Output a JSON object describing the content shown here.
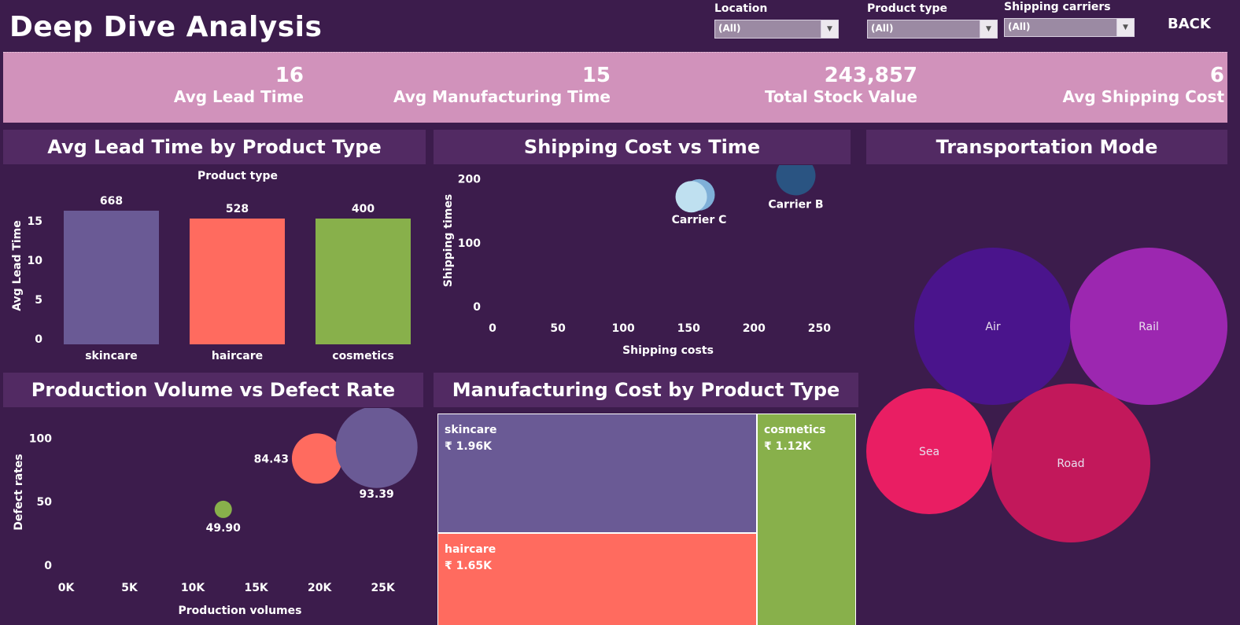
{
  "header": {
    "title": "Deep Dive Analysis",
    "back_label": "BACK"
  },
  "filters": [
    {
      "label": "Location",
      "value": "(All)"
    },
    {
      "label": "Product type",
      "value": "(All)"
    },
    {
      "label": "Shipping carriers",
      "value": "(All)"
    }
  ],
  "kpis": [
    {
      "value": "16",
      "label": "Avg Lead Time"
    },
    {
      "value": "15",
      "label": "Avg Manufacturing Time"
    },
    {
      "value": "243,857",
      "label": "Total Stock Value"
    },
    {
      "value": "6",
      "label": "Avg Shipping Cost"
    }
  ],
  "panels": {
    "lead_time": "Avg Lead Time by Product Type",
    "shipping": "Shipping Cost vs Time",
    "transport": "Transportation Mode",
    "defects": "Production Volume vs Defect Rate",
    "manufacturing": "Manufacturing Cost by Product Type"
  },
  "chart_data": [
    {
      "type": "bar",
      "title": "Avg Lead Time by Product Type",
      "header": "Product type",
      "ylabel": "Avg Lead Time",
      "categories": [
        "skincare",
        "haircare",
        "cosmetics"
      ],
      "values": [
        17,
        16,
        16
      ],
      "data_labels": [
        "668",
        "528",
        "400"
      ],
      "yticks": [
        "0",
        "5",
        "10",
        "15"
      ],
      "ylim": [
        0,
        20
      ],
      "colors": [
        "#6a5a95",
        "#ff6b5f",
        "#88b04b"
      ]
    },
    {
      "type": "scatter",
      "title": "Shipping Cost vs Time",
      "xlabel": "Shipping costs",
      "ylabel": "Shipping times",
      "xticks": [
        "0",
        "50",
        "100",
        "150",
        "200",
        "250"
      ],
      "yticks": [
        "0",
        "100",
        "200"
      ],
      "xlim": [
        0,
        260
      ],
      "ylim": [
        0,
        240
      ],
      "points": [
        {
          "name": "Carrier C",
          "x": 158,
          "y": 175,
          "color": "#7fb0d8",
          "size": 20
        },
        {
          "name": "",
          "x": 152,
          "y": 172,
          "color": "#bfe0f0",
          "size": 20
        },
        {
          "name": "Carrier B",
          "x": 232,
          "y": 205,
          "color": "#2a5482",
          "size": 25
        }
      ]
    },
    {
      "type": "scatter",
      "title": "Transportation Mode",
      "series": [
        {
          "name": "Air",
          "color": "#4a148c",
          "size": 100
        },
        {
          "name": "Rail",
          "color": "#9c27b0",
          "size": 100
        },
        {
          "name": "Sea",
          "color": "#e91e63",
          "size": 80
        },
        {
          "name": "Road",
          "color": "#c2185b",
          "size": 101
        }
      ]
    },
    {
      "type": "scatter",
      "title": "Production Volume vs Defect Rate",
      "xlabel": "Production volumes",
      "ylabel": "Defect rates",
      "xticks": [
        "0K",
        "5K",
        "10K",
        "15K",
        "20K",
        "25K"
      ],
      "yticks": [
        "0",
        "50",
        "100"
      ],
      "xlim": [
        0,
        27500
      ],
      "ylim": [
        0,
        130
      ],
      "points": [
        {
          "label": "49.90",
          "x": 12400,
          "y": 44,
          "color": "#88b04b",
          "size": 11
        },
        {
          "label": "84.43",
          "x": 19800,
          "y": 84,
          "color": "#ff6b5f",
          "size": 32
        },
        {
          "label": "93.39",
          "x": 24500,
          "y": 93,
          "color": "#6a5a95",
          "size": 52
        }
      ]
    },
    {
      "type": "treemap",
      "title": "Manufacturing Cost by Product Type",
      "cells": [
        {
          "name": "skincare",
          "value": "₹ 1.96K",
          "color": "#6a5a95"
        },
        {
          "name": "haircare",
          "value": "₹ 1.65K",
          "color": "#ff6b5f"
        },
        {
          "name": "cosmetics",
          "value": "₹ 1.12K",
          "color": "#88b04b"
        }
      ]
    }
  ]
}
